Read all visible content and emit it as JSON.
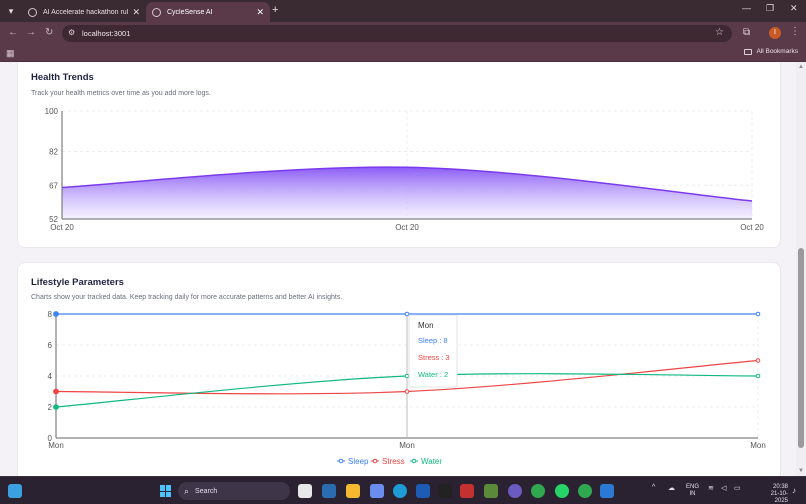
{
  "browser": {
    "tabs": [
      {
        "label": "AI Accelerate hackathon rules",
        "active": false
      },
      {
        "label": "CycleSense AI",
        "active": true
      }
    ],
    "url": "localhost:3001",
    "profile_initial": "I",
    "all_bookmarks_label": "All Bookmarks"
  },
  "health_trends": {
    "title": "Health Trends",
    "subtitle": "Track your health metrics over time as you add more logs."
  },
  "lifestyle": {
    "title": "Lifestyle Parameters",
    "subtitle": "Charts show your tracked data. Keep tracking daily for more accurate patterns and better AI insights."
  },
  "chart_data": [
    {
      "type": "area",
      "x": [
        "Oct 20",
        "Oct 20",
        "Oct 20"
      ],
      "series": [
        {
          "values": [
            66,
            75,
            60
          ]
        }
      ],
      "yticks": [
        52,
        67,
        82,
        100
      ],
      "ylim": [
        52,
        100
      ],
      "grid": true,
      "colors": {
        "stroke": "#7c3aed",
        "fill_top": "#8b5cf6",
        "fill_bottom": "#ede9fe"
      }
    },
    {
      "type": "line",
      "x": [
        "Mon",
        "Mon",
        "Mon"
      ],
      "series": [
        {
          "name": "Sleep",
          "values": [
            8,
            8,
            8
          ],
          "color": "#3b82f6"
        },
        {
          "name": "Stress",
          "values": [
            3,
            3,
            5
          ],
          "color": "#ef4444"
        },
        {
          "name": "Water",
          "values": [
            2,
            4,
            4
          ],
          "color": "#10b981"
        }
      ],
      "yticks": [
        0,
        2,
        4,
        6,
        8
      ],
      "ylim": [
        0,
        8
      ],
      "grid": true,
      "legend": "bottom-center",
      "tooltip": {
        "title": "Mon",
        "items": [
          {
            "label": "Sleep : 8",
            "color": "#3b82f6"
          },
          {
            "label": "Stress : 3",
            "color": "#ef4444"
          },
          {
            "label": "Water : 2",
            "color": "#10b981"
          }
        ]
      }
    }
  ],
  "taskbar": {
    "search_label": "Search",
    "lang": [
      "ENG",
      "IN"
    ],
    "time": "20:38",
    "date": "21-10-2025"
  }
}
